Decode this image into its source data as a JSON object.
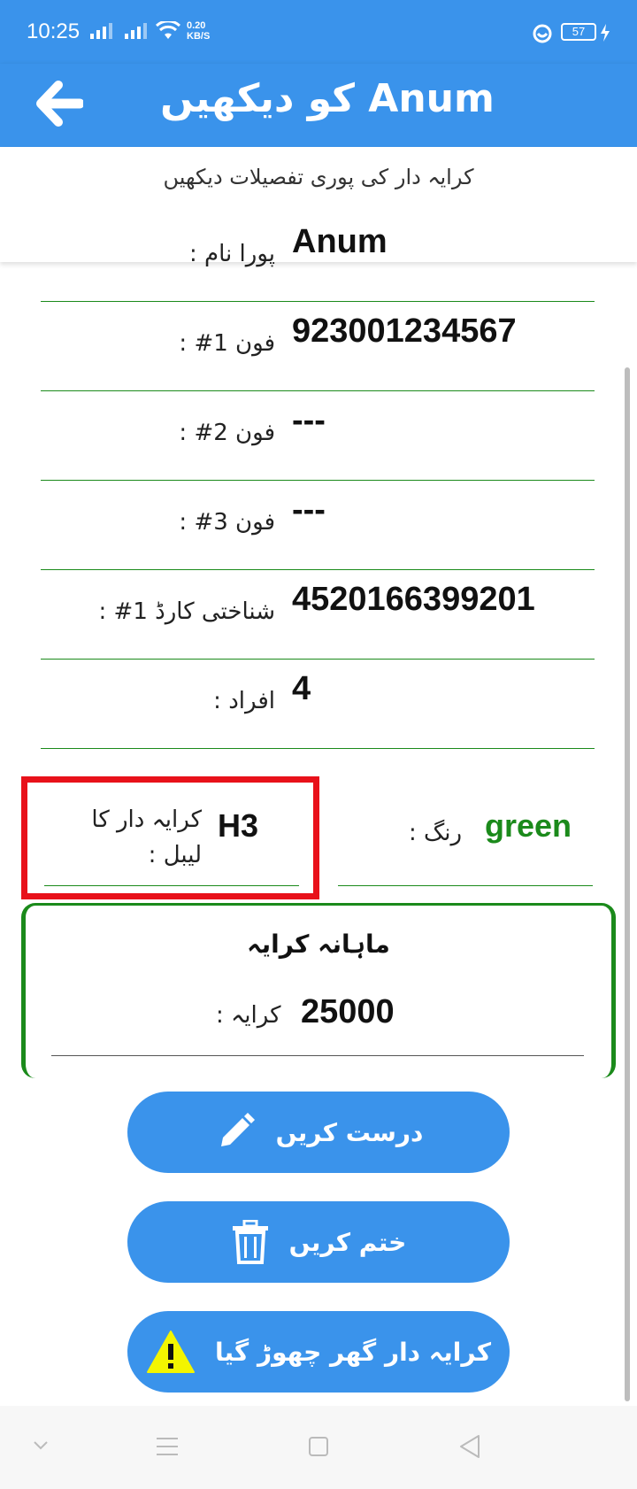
{
  "status_bar": {
    "time": "10:25",
    "net_speed_value": "0.20",
    "net_speed_unit": "KB/S",
    "battery": "57"
  },
  "header": {
    "title": "Anum کو دیکھیں",
    "back_icon": "arrow-left-icon"
  },
  "subtitle": "کرایہ دار کی پوری تفصیلات دیکھیں",
  "fields": [
    {
      "label": "پورا نام :",
      "value": "Anum"
    },
    {
      "label": "فون 1# :",
      "value": "923001234567"
    },
    {
      "label": "فون 2# :",
      "value": "---"
    },
    {
      "label": "فون 3# :",
      "value": "---"
    },
    {
      "label": "شناختی کارڈ 1# :",
      "value": "4520166399201"
    },
    {
      "label": "افراد :",
      "value": "4"
    }
  ],
  "tenant_label": {
    "label": "کرایہ دار کا لیبل :",
    "value": "H3"
  },
  "color": {
    "label": "رنگ :",
    "value": "green",
    "value_color": "#1b8a1b"
  },
  "rent": {
    "title": "ماہانہ کرایہ",
    "label": "کرایہ :",
    "value": "25000"
  },
  "buttons": {
    "edit": {
      "label": "درست کریں",
      "icon": "pencil-icon"
    },
    "delete": {
      "label": "ختم کریں",
      "icon": "trash-icon"
    },
    "left": {
      "label": "کرایہ دار گھر چھوڑ گیا",
      "icon": "warning-icon"
    }
  },
  "colors": {
    "primary": "#3a93eb",
    "highlight": "#e8111a",
    "divider": "#1b8a1b"
  }
}
